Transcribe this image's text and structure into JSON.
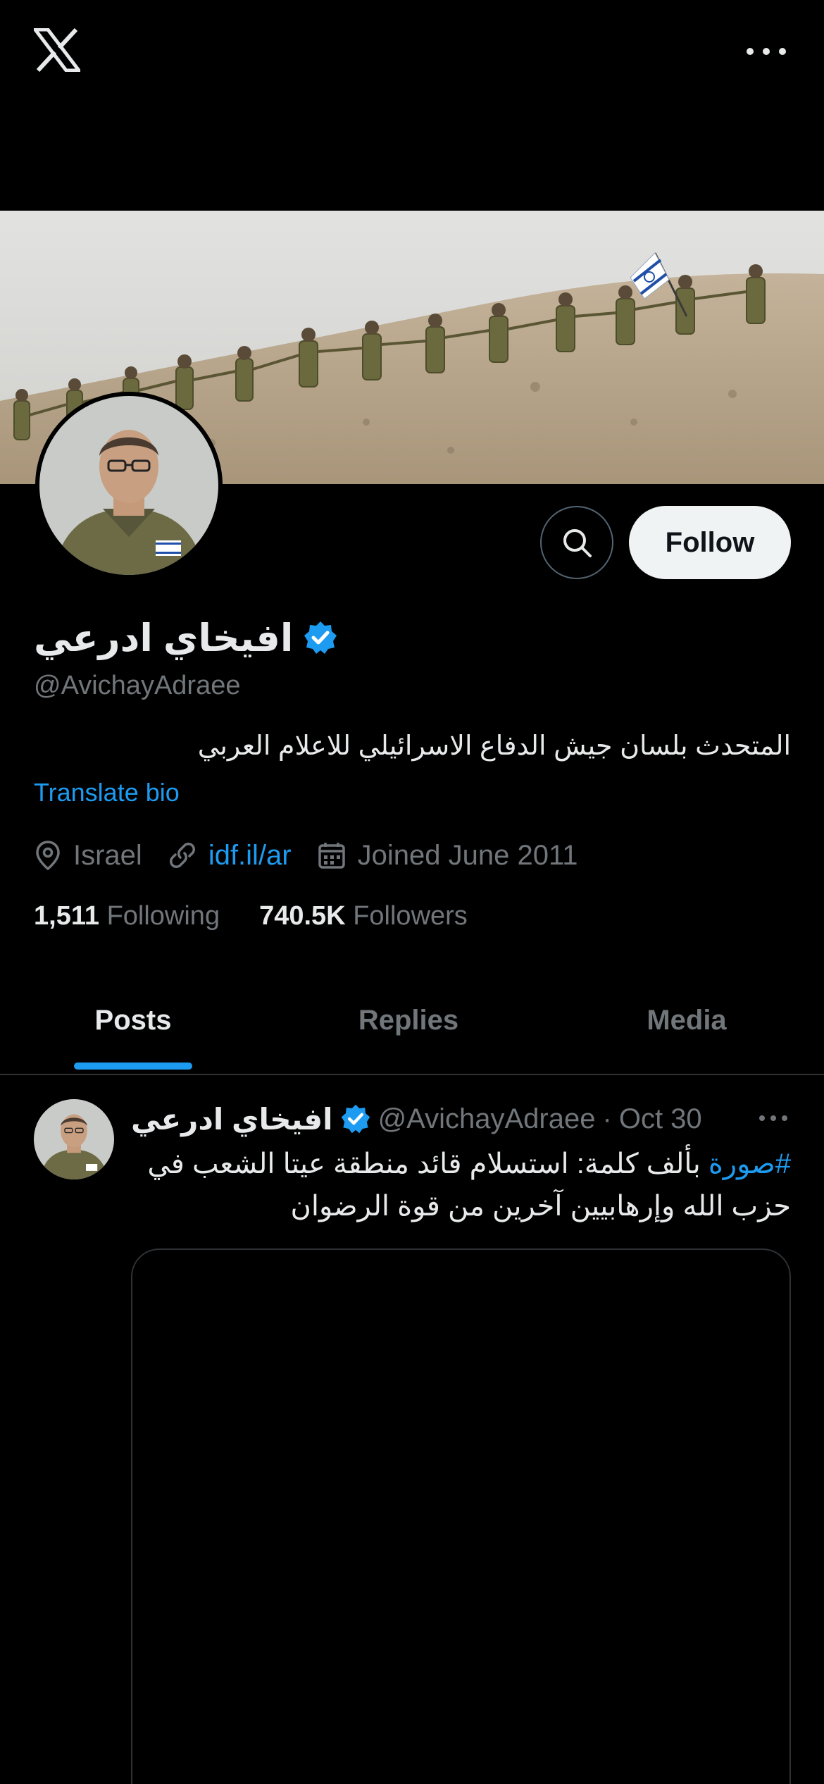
{
  "top_bar": {
    "logo_icon": "x-logo-icon",
    "more_icon": "more-horizontal-icon"
  },
  "profile": {
    "display_name": "افيخاي ادرعي",
    "verified": true,
    "handle": "@AvichayAdraee",
    "bio": "المتحدث بلسان جيش الدفاع الاسرائيلي للاعلام العربي",
    "translate_label": "Translate bio",
    "location": "Israel",
    "website": "idf.il/ar",
    "joined": "Joined June 2011",
    "following_count": "1,511",
    "following_label": "Following",
    "followers_count": "740.5K",
    "followers_label": "Followers"
  },
  "actions": {
    "follow_label": "Follow",
    "search_icon": "search-icon"
  },
  "tabs": [
    {
      "label": "Posts",
      "active": true
    },
    {
      "label": "Replies",
      "active": false
    },
    {
      "label": "Media",
      "active": false
    }
  ],
  "post": {
    "author_name": "افيخاي ادرعي",
    "author_handle": "@AvichayAdraee",
    "separator": "·",
    "date": "Oct 30",
    "hashtag": "#صورة",
    "text": " بألف كلمة: استسلام قائد منطقة عيتا الشعب في حزب الله وإرهابيين آخرين من قوة الرضوان"
  },
  "colors": {
    "background": "#000000",
    "accent": "#1d9bf0",
    "text_primary": "#e7e9ea",
    "text_secondary": "#71767b",
    "border": "#2f3336"
  }
}
